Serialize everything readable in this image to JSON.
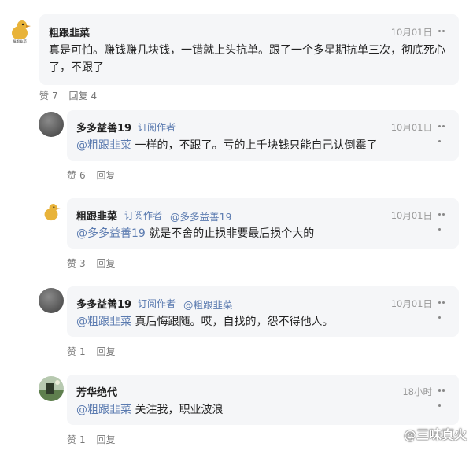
{
  "comments": [
    {
      "name": "粗跟韭菜",
      "date": "10月01日",
      "text": "真是可怕。赚钱赚几块钱，一错就上头抗单。跟了一个多星期抗单三次，彻底死心了，不跟了",
      "like_label": "赞",
      "like_count": "7",
      "reply_label": "回复",
      "reply_count": "4",
      "avatar_text": "粗跟韭菜"
    },
    {
      "name": "多多益善19",
      "tag": "订阅作者",
      "date": "10月01日",
      "mention": "@粗跟韭菜",
      "text": " 一样的，不跟了。亏的上千块钱只能自己认倒霉了",
      "like_label": "赞",
      "like_count": "6",
      "reply_label": "回复"
    },
    {
      "name": "粗跟韭菜",
      "tag": "订阅作者",
      "reply_to": "@多多益善19",
      "date": "10月01日",
      "mention": "@多多益善19",
      "text": " 就是不舍的止损非要最后损个大的",
      "like_label": "赞",
      "like_count": "3",
      "reply_label": "回复"
    },
    {
      "name": "多多益善19",
      "tag": "订阅作者",
      "reply_to": "@粗跟韭菜",
      "date": "10月01日",
      "mention": "@粗跟韭菜",
      "text": " 真后悔跟随。哎，自找的，怨不得他人。",
      "like_label": "赞",
      "like_count": "1",
      "reply_label": "回复"
    },
    {
      "name": "芳华绝代",
      "date": "18小时",
      "mention": "@粗跟韭菜",
      "text": " 关注我，职业波浪",
      "like_label": "赞",
      "like_count": "1",
      "reply_label": "回复"
    }
  ],
  "watermark": "@三味真火",
  "colors": {
    "bubble_bg": "#f5f6f8",
    "link": "#5b7bb0",
    "meta": "#999999"
  }
}
